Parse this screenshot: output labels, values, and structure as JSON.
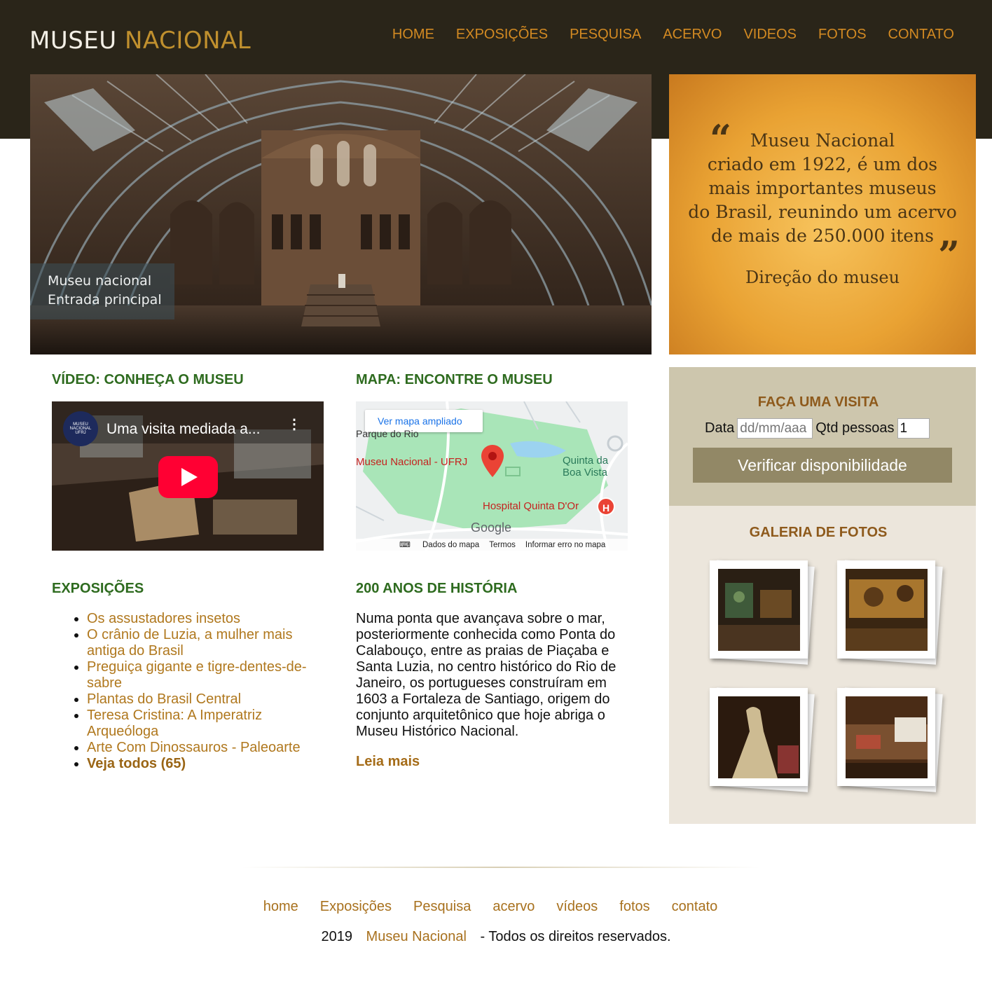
{
  "header": {
    "logo_part1": "MUSEU",
    "logo_part2": "NACIONAL",
    "nav": [
      "HOME",
      "EXPOSIÇÕES",
      "PESQUISA",
      "ACERVO",
      "VIDEOS",
      "FOTOS",
      "CONTATO"
    ]
  },
  "hero": {
    "caption_line1": "Museu nacional",
    "caption_line2": "Entrada principal"
  },
  "quote": {
    "open_mark": "“",
    "close_mark": "”",
    "lines": [
      "Museu Nacional",
      "criado em 1922, é um dos",
      "mais importantes museus",
      "do Brasil, reunindo um acervo",
      "de mais de 250.000 itens"
    ],
    "author": "Direção do museu"
  },
  "video_section": {
    "title": "VÍDEO: CONHEÇA O MUSEU",
    "video_title": "Uma visita mediada a...",
    "channel_label": "MUSEU NACIONAL",
    "channel_sub": "UFRJ"
  },
  "map_section": {
    "title": "MAPA: ENCONTRE O MUSEU",
    "view_larger": "Ver mapa ampliado",
    "park_label": "Parque do Rio",
    "place_label": "Museu Nacional - UFRJ",
    "area_label_1": "Quinta da",
    "area_label_2": "Boa Vista",
    "hospital_label": "Hospital Quinta D'Or",
    "google": "Google",
    "footer_links": [
      "Dados do mapa",
      "Termos",
      "Informar erro no mapa"
    ]
  },
  "exhibitions": {
    "title": "EXPOSIÇÕES",
    "items": [
      "Os assustadores insetos",
      "O crânio de Luzia, a mulher mais antiga do Brasil",
      "Preguiça gigante e tigre-dentes-de-sabre",
      "Plantas do Brasil Central",
      "Teresa Cristina: A Imperatriz Arqueóloga",
      "Arte Com Dinossauros - Paleoarte"
    ],
    "see_all": "Veja todos (65)"
  },
  "history": {
    "title": "200 ANOS DE HISTÓRIA",
    "text": "Numa ponta que avançava sobre o mar, posteriormente conhecida como Ponta do Calabouço, entre as praias de Piaçaba e Santa Luzia, no centro histórico do Rio de Janeiro, os portugueses construíram em 1603 a Fortaleza de Santiago, origem do conjunto arquitetônico que hoje abriga o Museu Histórico Nacional.",
    "read_more": "Leia mais"
  },
  "visit": {
    "title": "FAÇA UMA VISITA",
    "date_label": "Data",
    "date_placeholder": "dd/mm/aaa",
    "qty_label": "Qtd pessoas",
    "qty_value": "1",
    "button": "Verificar disponibilidade"
  },
  "gallery": {
    "title": "GALERIA DE FOTOS"
  },
  "footer": {
    "nav": [
      "home",
      "Exposições",
      "Pesquisa",
      "acervo",
      "vídeos",
      "fotos",
      "contato"
    ],
    "year": "2019",
    "site": "Museu Nacional",
    "rights": "- Todos os direitos reservados."
  },
  "colors": {
    "header_bg": "#2a2519",
    "nav_accent": "#d38a22",
    "section_title": "#2e6b1f",
    "link": "#b0781e",
    "visit_bg": "#cdc6ad",
    "gallery_bg": "#ece6dc",
    "button_bg": "#928866"
  }
}
